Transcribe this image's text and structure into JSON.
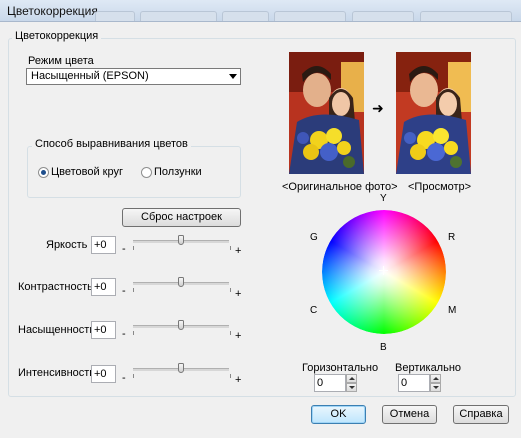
{
  "window": {
    "title": "Цветокоррекция"
  },
  "group_title": "Цветокоррекция",
  "color_mode": {
    "label": "Режим цвета",
    "selected": "Насыщенный (EPSON)"
  },
  "alignment": {
    "title": "Способ выравнивания цветов",
    "options": [
      {
        "label": "Цветовой круг",
        "selected": true
      },
      {
        "label": "Ползунки",
        "selected": false
      }
    ]
  },
  "reset_button": "Сброс настроек",
  "sliders": [
    {
      "label": "Яркость",
      "value": "+0",
      "minus": "-",
      "plus": "+",
      "level": 0
    },
    {
      "label": "Контрастность",
      "value": "+0",
      "minus": "-",
      "plus": "+",
      "level": 0
    },
    {
      "label": "Насыщенность",
      "value": "+0",
      "minus": "-",
      "plus": "+",
      "level": 0
    },
    {
      "label": "Интенсивность",
      "value": "+0",
      "minus": "-",
      "plus": "+",
      "level": 0
    }
  ],
  "preview": {
    "original_caption": "<Оригинальное фото>",
    "preview_caption": "<Просмотр>",
    "arrow_icon": "arrow-right-icon"
  },
  "wheel": {
    "labels": {
      "Y": "Y",
      "R": "R",
      "M": "M",
      "B": "B",
      "C": "C",
      "G": "G"
    },
    "horizontal_label": "Горизонтально",
    "horizontal_value": "0",
    "vertical_label": "Вертикально",
    "vertical_value": "0"
  },
  "buttons": {
    "ok": "OK",
    "cancel": "Отмена",
    "help": "Справка"
  },
  "colors": {
    "title_bar": "#c9d8ea",
    "dialog_bg": "#f0f0f0",
    "default_button": "#bee6fd"
  }
}
